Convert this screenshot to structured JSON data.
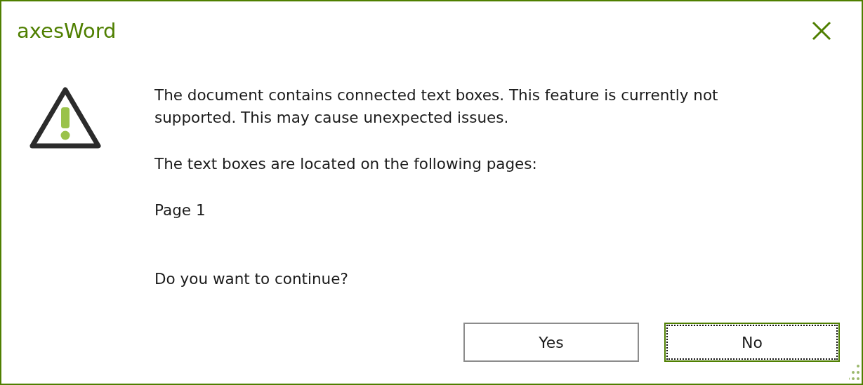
{
  "window": {
    "title": "axesWord"
  },
  "message": [
    "The document contains connected text boxes. This feature is currently not supported. This may cause unexpected issues.",
    "The text boxes are located on the following pages:",
    "Page 1"
  ],
  "question": "Do you want to continue?",
  "buttons": [
    {
      "label": "Yes",
      "focused": false
    },
    {
      "label": "No",
      "focused": true
    }
  ]
}
